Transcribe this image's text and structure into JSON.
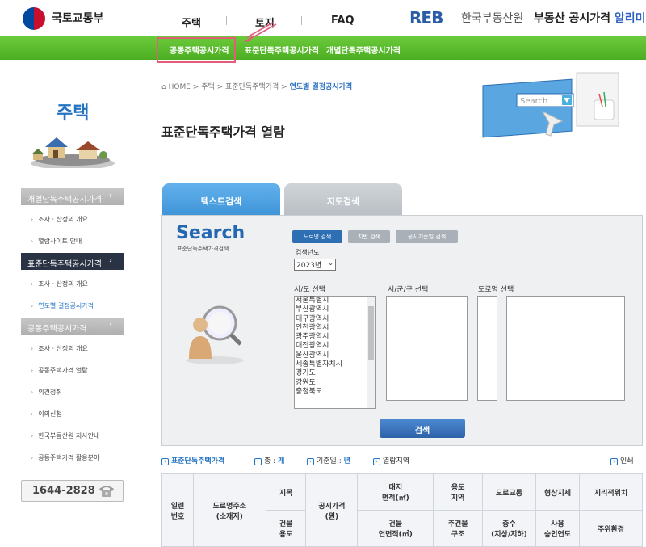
{
  "header": {
    "gov_name": "국토교통부",
    "nav": [
      "주택",
      "토지",
      "FAQ"
    ],
    "reb_logo": "REB",
    "reb_name": "한국부동산원",
    "reb_service_prefix": "부동산 공시가격",
    "reb_service_suffix": "알리미"
  },
  "subnav": [
    "공동주택공시가격",
    "표준단독주택공시가격",
    "개별단독주택공시가격"
  ],
  "sidebar": {
    "title": "주택",
    "groups": [
      {
        "label": "개별단독주택공시가격",
        "items": [
          "조사 · 산정의 개요",
          "열람사이트 안내"
        ]
      },
      {
        "label": "표준단독주택공시가격",
        "items": [
          "조사 · 산정의 개요",
          "연도별 결정공시가격"
        ]
      },
      {
        "label": "공동주택공시가격",
        "items": [
          "조사 · 산정의 개요",
          "공동주택가격 열람",
          "의견청취",
          "이의신청",
          "한국부동산원 지사안내",
          "공동주택가격 활용분야"
        ]
      }
    ],
    "phone": "1644-2828"
  },
  "breadcrumb": [
    "HOME",
    "주택",
    "표준단독주택가격",
    "연도별 결정공시가격"
  ],
  "page_title": "표준단독주택가격 열람",
  "tabs": [
    "텍스트검색",
    "지도검색"
  ],
  "search": {
    "logo": "Search",
    "subtitle": "표준단독주택가격검색",
    "buttons": [
      "도로명 검색",
      "지번 검색",
      "공시기준일 검색"
    ],
    "year_label": "검색년도",
    "year_value": "2023년",
    "col_labels": [
      "시/도 선택",
      "시/군/구 선택",
      "도로명 선택"
    ],
    "sido_options": [
      "서울특별시",
      "부산광역시",
      "대구광역시",
      "인천광역시",
      "광주광역시",
      "대전광역시",
      "울산광역시",
      "세종특별자치시",
      "경기도",
      "강원도",
      "충청북도"
    ],
    "submit": "검색"
  },
  "results_bar": {
    "category": "표준단독주택가격",
    "total_label": "총 :",
    "total_unit": "개",
    "base_date_label": "기준일 :",
    "base_date_unit": "년",
    "region_label": "열람지역 :",
    "print": "인쇄"
  },
  "table": {
    "headers": {
      "seq": "일련\n번호",
      "address": "도로명주소\n(소재지)",
      "jimok": "지목",
      "building_use": "건물\n용도",
      "price": "공시가격\n(원)",
      "land_area": "대지\n면적(㎡)",
      "floor_area": "건물\n연면적(㎡)",
      "zone": "용도\n지역",
      "structure": "주건물\n구조",
      "road": "도로교통",
      "floors": "층수\n(지상/지하)",
      "shape": "형상지세",
      "year": "사용\n승인연도",
      "location": "지리적위치",
      "environment": "주위환경"
    }
  }
}
